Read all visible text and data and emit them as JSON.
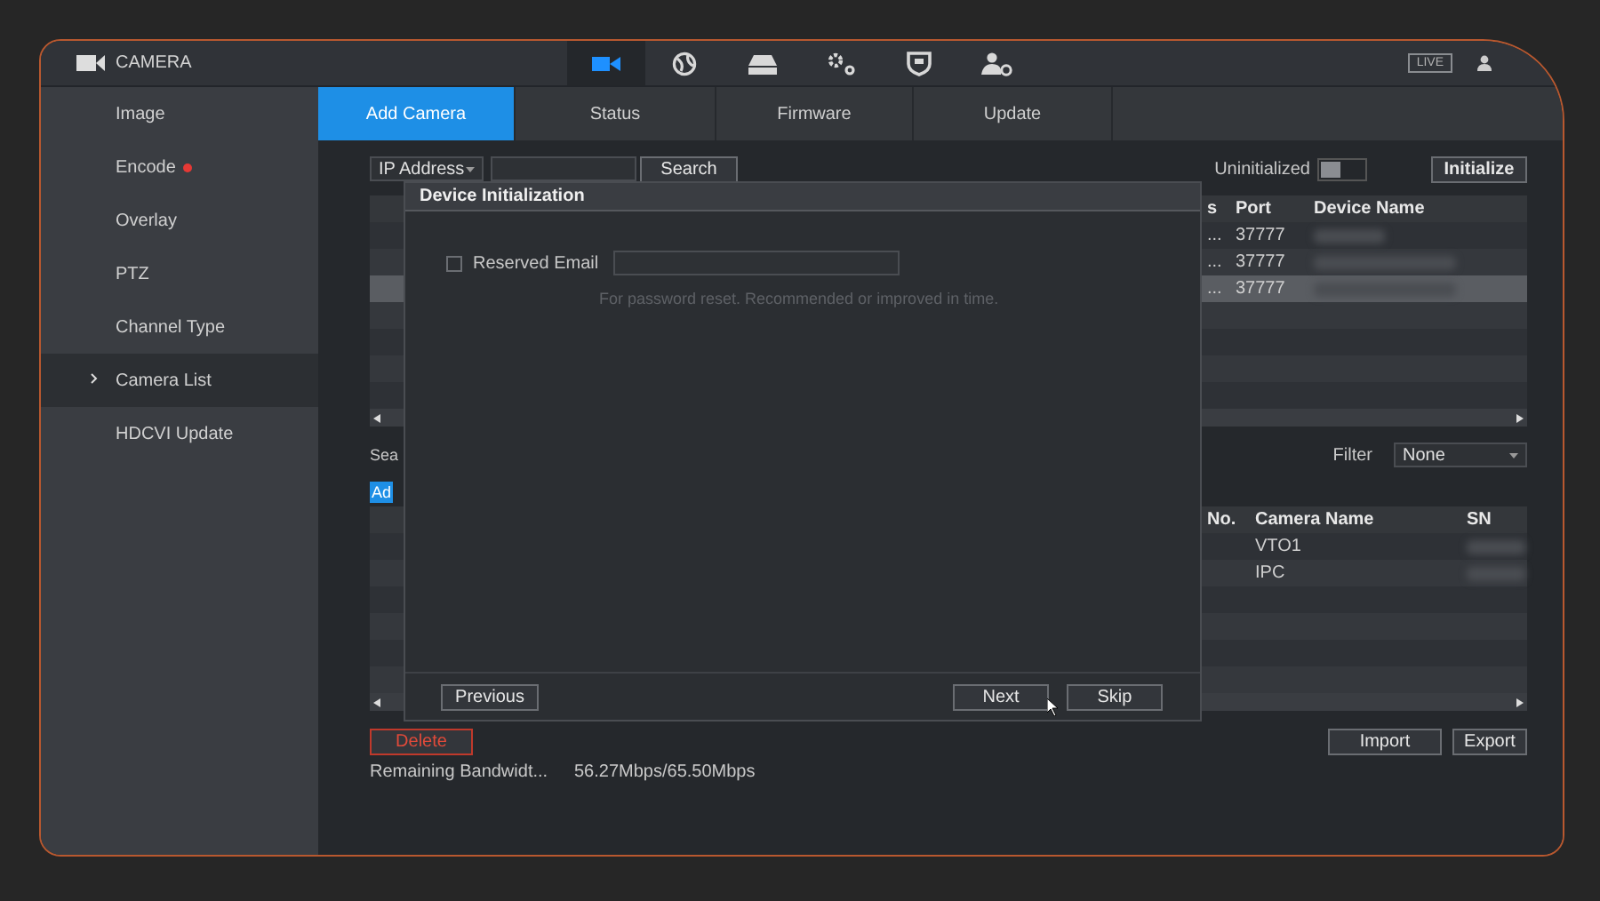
{
  "header": {
    "title": "CAMERA",
    "nav": [
      {
        "kind": "camera",
        "selected": true
      },
      {
        "kind": "network",
        "selected": false
      },
      {
        "kind": "storage",
        "selected": false
      },
      {
        "kind": "system",
        "selected": false
      },
      {
        "kind": "security",
        "selected": false
      },
      {
        "kind": "account",
        "selected": false
      }
    ],
    "live_badge": "LIVE"
  },
  "sidebar": {
    "items": [
      {
        "label": "Image",
        "selected": false,
        "alert": false
      },
      {
        "label": "Encode",
        "selected": false,
        "alert": true
      },
      {
        "label": "Overlay",
        "selected": false,
        "alert": false
      },
      {
        "label": "PTZ",
        "selected": false,
        "alert": false
      },
      {
        "label": "Channel Type",
        "selected": false,
        "alert": false
      },
      {
        "label": "Camera List",
        "selected": true,
        "alert": false
      },
      {
        "label": "HDCVI Update",
        "selected": false,
        "alert": false
      }
    ]
  },
  "tabs": [
    {
      "label": "Add Camera",
      "selected": true
    },
    {
      "label": "Status",
      "selected": false
    },
    {
      "label": "Firmware",
      "selected": false
    },
    {
      "label": "Update",
      "selected": false
    }
  ],
  "search_bar": {
    "search_type": "IP Address",
    "search_button": "Search",
    "uninitialized_label": "Uninitialized",
    "uninitialized_on": false,
    "initialize_button": "Initialize"
  },
  "device_table": {
    "columns": [
      "s",
      "Port",
      "Device Name"
    ],
    "rows": [
      {
        "column_1": "...",
        "port": "37777",
        "selected": false
      },
      {
        "column_1": "...",
        "port": "37777",
        "selected": false
      },
      {
        "column_1": "...",
        "port": "37777",
        "selected": true
      }
    ]
  },
  "added_section": {
    "label": "Sea",
    "add_button": "Ad",
    "filter_label": "Filter",
    "filter_value": "None",
    "columns": [
      "No.",
      "Camera Name",
      "SN"
    ],
    "rows": [
      {
        "camera_name": "VTO1"
      },
      {
        "camera_name": "IPC"
      }
    ]
  },
  "footer": {
    "delete_button": "Delete",
    "import_button": "Import",
    "export_button": "Export",
    "bandwidth_label": "Remaining Bandwidt...",
    "bandwidth_value": "56.27Mbps/65.50Mbps"
  },
  "dialog": {
    "title": "Device Initialization",
    "email_checkbox": {
      "label": "Reserved Email",
      "checked": false
    },
    "hint": "For password reset. Recommended or improved in time.",
    "buttons": [
      "Previous",
      "Next",
      "Skip"
    ]
  }
}
